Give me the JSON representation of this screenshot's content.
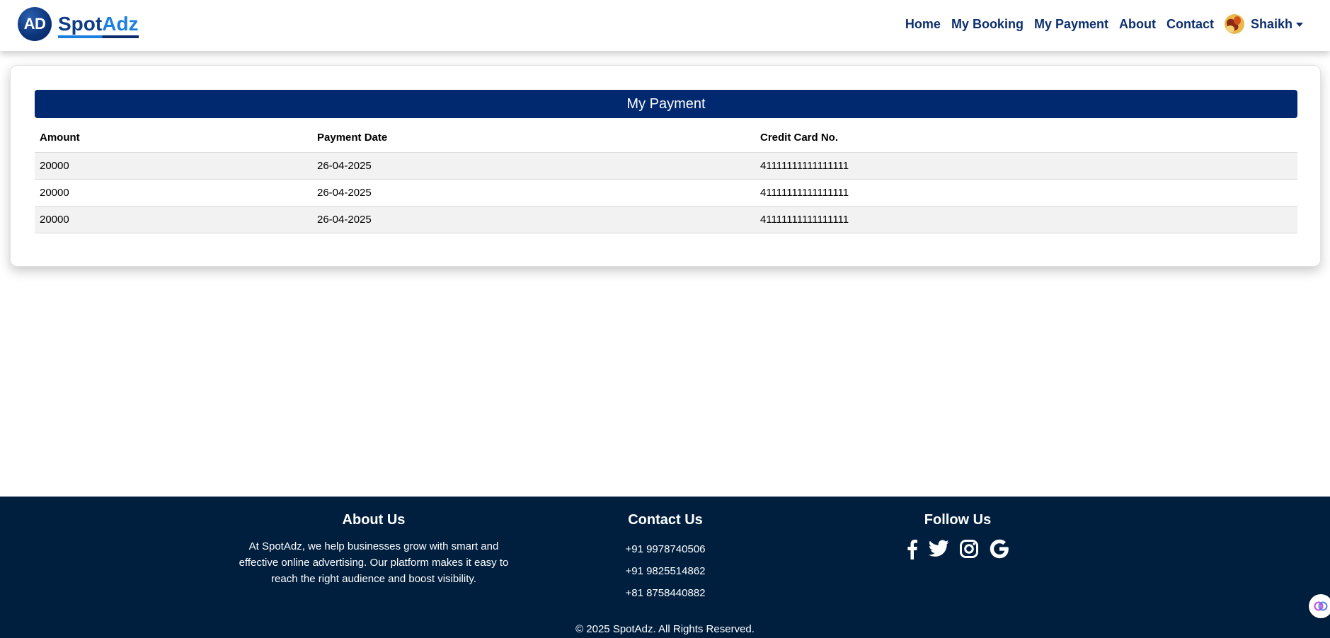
{
  "brand": {
    "logo_text": "AD",
    "name_part1": "Spot",
    "name_part2": "Adz"
  },
  "nav": {
    "links": [
      "Home",
      "My Booking",
      "My Payment",
      "About",
      "Contact"
    ],
    "user_name": "Shaikh"
  },
  "payments": {
    "title": "My Payment",
    "columns": [
      "Amount",
      "Payment Date",
      "Credit Card No."
    ],
    "rows": [
      [
        "20000",
        "26-04-2025",
        "41111111111111111"
      ],
      [
        "20000",
        "26-04-2025",
        "41111111111111111"
      ],
      [
        "20000",
        "26-04-2025",
        "41111111111111111"
      ]
    ]
  },
  "footer": {
    "about_title": "About Us",
    "about_text": "At SpotAdz, we help businesses grow with smart and effective online advertising. Our platform makes it easy to reach the right audience and boost visibility.",
    "contact_title": "Contact Us",
    "phones": [
      "+91 9978740506",
      "+91 9825514862",
      "+81 8758440882"
    ],
    "follow_title": "Follow Us",
    "social_icons": [
      "facebook-icon",
      "twitter-icon",
      "instagram-icon",
      "google-icon"
    ],
    "copyright": "© 2025 SpotAdz. All Rights Reserved."
  },
  "colors": {
    "navy": "#012970",
    "footer_bg": "#001f3f",
    "brand_blue": "#1a7fe0"
  }
}
